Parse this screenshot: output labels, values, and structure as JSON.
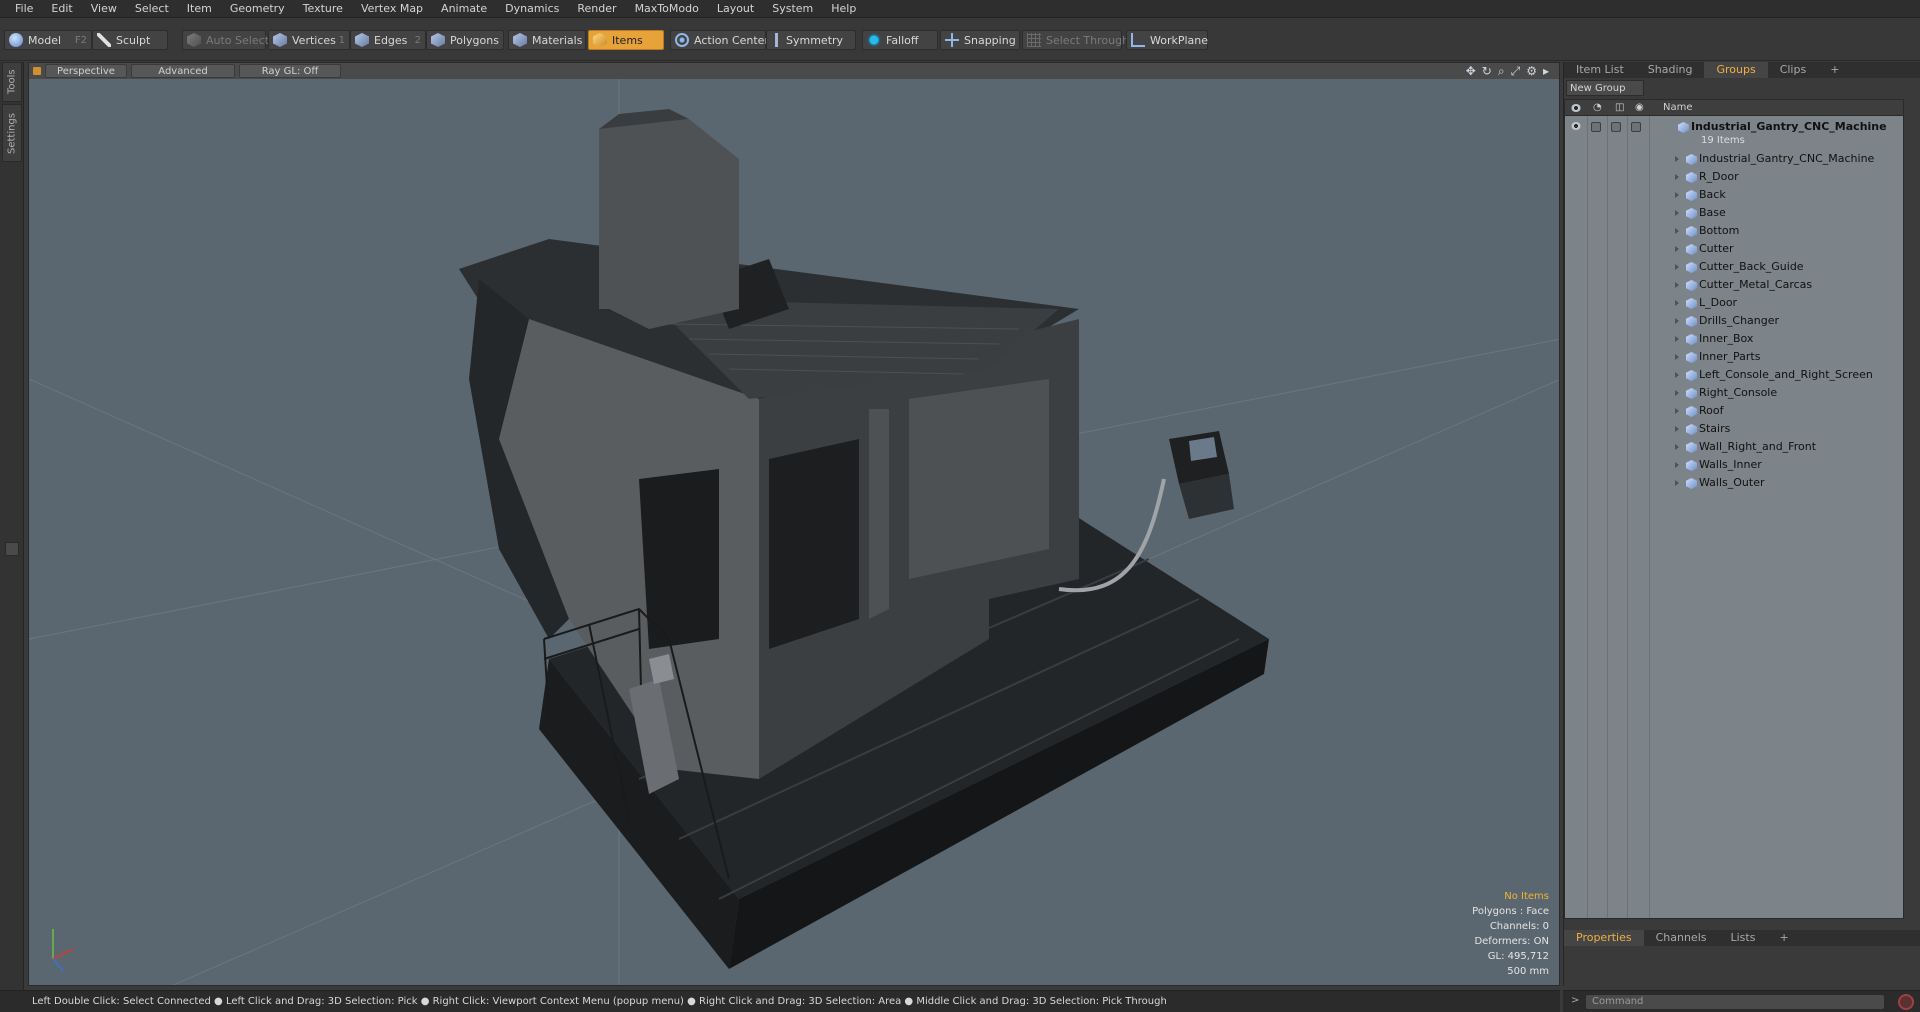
{
  "menu": [
    "File",
    "Edit",
    "View",
    "Select",
    "Item",
    "Geometry",
    "Texture",
    "Vertex Map",
    "Animate",
    "Dynamics",
    "Render",
    "MaxToModo",
    "Layout",
    "System",
    "Help"
  ],
  "toolbar": {
    "model": "Model",
    "model_key": "F2",
    "sculpt": "Sculpt",
    "auto_select": "Auto Select",
    "vertices": "Vertices",
    "vertices_key": "1",
    "edges": "Edges",
    "edges_key": "2",
    "polygons": "Polygons",
    "materials": "Materials",
    "items": "Items",
    "action_center": "Action Center",
    "symmetry": "Symmetry",
    "falloff": "Falloff",
    "snapping": "Snapping",
    "select_through": "Select Through",
    "workplane": "WorkPlane",
    "active_color": "#e8a23a"
  },
  "sidebar": {
    "tools": "Tools",
    "settings": "Settings"
  },
  "viewport": {
    "view": "Perspective",
    "shading": "Advanced",
    "raygl": "Ray GL: Off",
    "info": {
      "selection": "No Items",
      "polygons": "Polygons : Face",
      "channels": "Channels: 0",
      "deformers": "Deformers: ON",
      "gl": "GL: 495,712",
      "scale": "500 mm"
    },
    "background_color": "#5b6770"
  },
  "right_panel": {
    "tabs": [
      "Item List",
      "Shading",
      "Groups",
      "Clips",
      "+"
    ],
    "active_tab": "Groups",
    "new_group": "New Group",
    "column_name": "Name",
    "group_name": "Industrial_Gantry_CNC_Machine",
    "group_count": "19 Items",
    "items": [
      "Industrial_Gantry_CNC_Machine",
      "R_Door",
      "Back",
      "Base",
      "Bottom",
      "Cutter",
      "Cutter_Back_Guide",
      "Cutter_Metal_Carcas",
      "L_Door",
      "Drills_Changer",
      "Inner_Box",
      "Inner_Parts",
      "Left_Console_and_Right_Screen",
      "Right_Console",
      "Roof",
      "Stairs",
      "Wall_Right_and_Front",
      "Walls_Inner",
      "Walls_Outer"
    ],
    "bottom_tabs": [
      "Properties",
      "Channels",
      "Lists",
      "+"
    ],
    "bottom_active": "Properties"
  },
  "statusbar": "Left Double Click: Select Connected ● Left Click and Drag: 3D Selection: Pick ● Right Click: Viewport Context Menu (popup menu) ● Right Click and Drag: 3D Selection: Area ● Middle Click and Drag: 3D Selection: Pick Through",
  "command": {
    "placeholder": "Command",
    "prompt": ">"
  }
}
